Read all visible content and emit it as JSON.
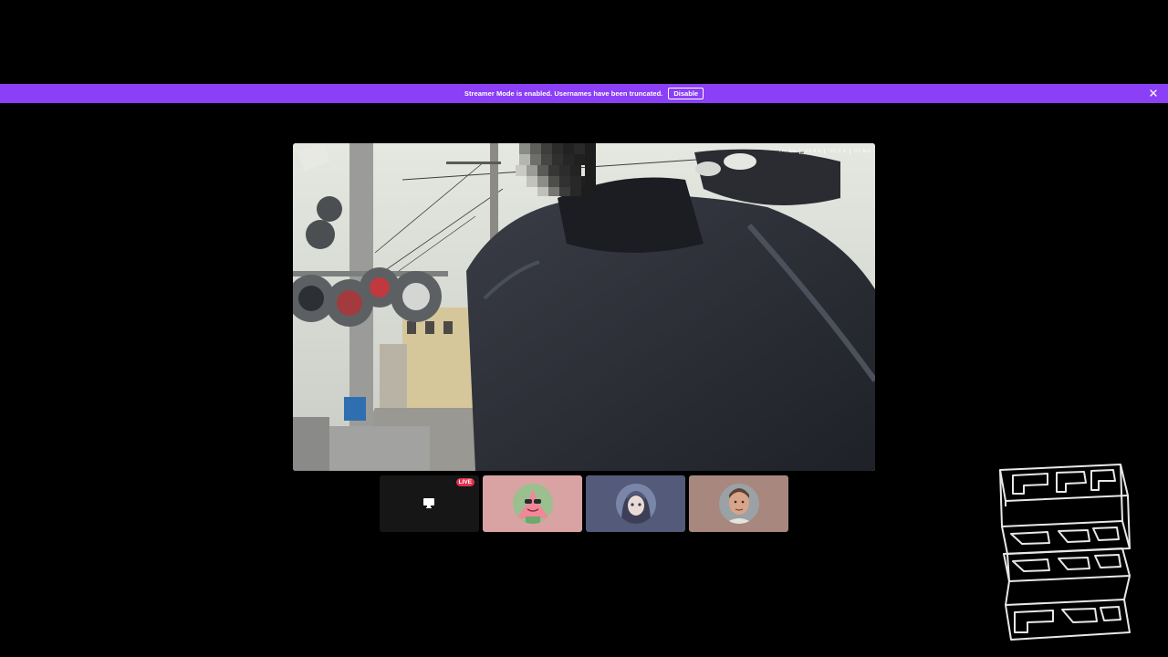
{
  "banner": {
    "message": "Streamer Mode is enabled. Usernames have been truncated.",
    "button": "Disable",
    "color": "#8b3ff6"
  },
  "stats": [
    {
      "label": "FPS",
      "value": "N/A"
    },
    {
      "label": "GPU",
      "value": "9 %"
    },
    {
      "label": "CPU",
      "value": "5 %"
    },
    {
      "label": "LAT",
      "value": "N/A"
    }
  ],
  "tiles": [
    {
      "name": "screen-share",
      "badge": "LIVE",
      "icon": "monitor-icon",
      "color": "#161616"
    },
    {
      "name": "participant-1",
      "icon": "starfish-avatar",
      "color": "#d9a3a3"
    },
    {
      "name": "participant-2",
      "icon": "anime-avatar",
      "color": "#535a7a"
    },
    {
      "name": "participant-3",
      "icon": "man-avatar",
      "color": "#a8877f"
    }
  ],
  "icons": {
    "close": "close-icon",
    "logo": "wireframe-logo-icon"
  }
}
